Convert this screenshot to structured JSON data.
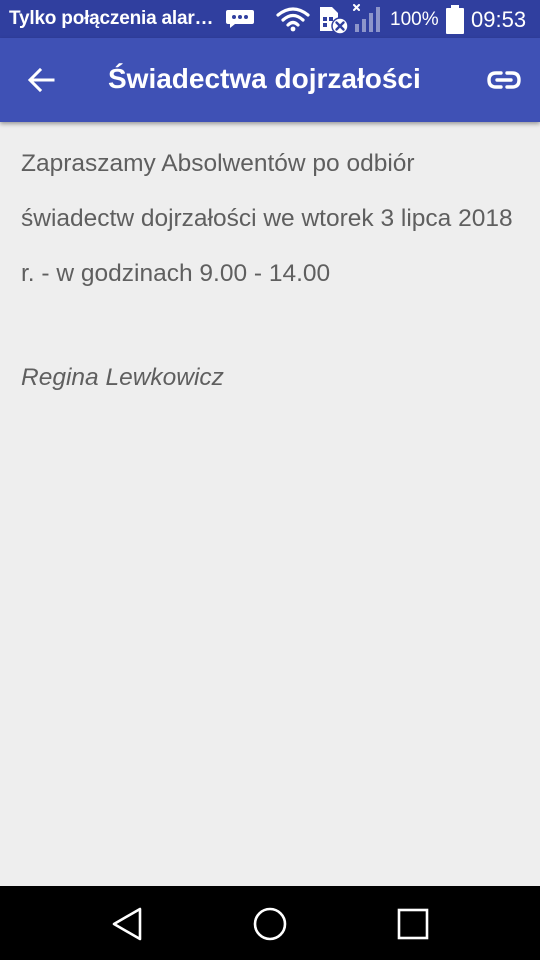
{
  "status_bar": {
    "carrier": "Tylko połączenia alar…",
    "battery_percent": "100%",
    "time": "09:53",
    "icons": [
      "message-icon",
      "wifi-icon",
      "sim-card-icon",
      "signal-icon",
      "battery-icon"
    ]
  },
  "app_bar": {
    "title": "Świadectwa dojrzałości",
    "back_icon": "arrow-back-icon",
    "link_icon": "link-icon"
  },
  "content": {
    "paragraph": "Zapraszamy Absolwentów po odbiór świadectw dojrzałości we wtorek 3 lipca 2018 r. -  w godzinach 9.00 - 14.00",
    "signature": "Regina Lewkowicz"
  },
  "nav_bar": {
    "icons": [
      "nav-back-icon",
      "nav-home-icon",
      "nav-recents-icon"
    ]
  },
  "colors": {
    "status_bar": "#303F9F",
    "app_bar": "#3F51B5",
    "background": "#EEEEEE",
    "text": "#5F5F5F"
  }
}
